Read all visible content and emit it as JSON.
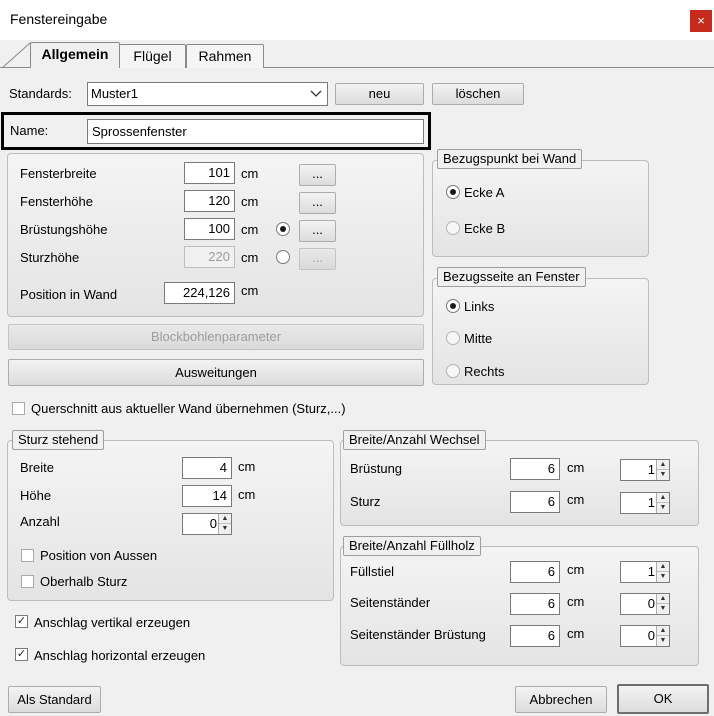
{
  "window": {
    "title": "Fenstereingabe",
    "close_label": "×"
  },
  "tabs": [
    {
      "label": "Allgemein"
    },
    {
      "label": "Flügel"
    },
    {
      "label": "Rahmen"
    }
  ],
  "standards": {
    "label": "Standards:",
    "value": "Muster1",
    "new_label": "neu",
    "delete_label": "löschen"
  },
  "name": {
    "label": "Name:",
    "value": "Sprossenfenster"
  },
  "dimensions": {
    "fensterbreite": {
      "label": "Fensterbreite",
      "value": "101",
      "unit": "cm",
      "dots": "..."
    },
    "fensterhoehe": {
      "label": "Fensterhöhe",
      "value": "120",
      "unit": "cm",
      "dots": "..."
    },
    "bruestungshoehe": {
      "label": "Brüstungshöhe",
      "value": "100",
      "unit": "cm",
      "dots": "..."
    },
    "sturzhoehe": {
      "label": "Sturzhöhe",
      "value": "220",
      "unit": "cm",
      "dots": "..."
    },
    "position_in_wand": {
      "label": "Position in Wand",
      "value": "224,126",
      "unit": "cm"
    }
  },
  "buttons": {
    "blockbohlen": "Blockbohlenparameter",
    "ausweitungen": "Ausweitungen",
    "als_standard": "Als Standard",
    "abbrechen": "Abbrechen",
    "ok": "OK"
  },
  "bezugspunkt": {
    "legend": "Bezugspunkt bei Wand",
    "options": [
      "Ecke A",
      "Ecke B"
    ],
    "selected": "Ecke A"
  },
  "bezugsseite": {
    "legend": "Bezugsseite an Fenster",
    "options": [
      "Links",
      "Mitte",
      "Rechts"
    ],
    "selected": "Links"
  },
  "querschnitt": {
    "label": "Querschnitt aus aktueller Wand übernehmen (Sturz,...)",
    "checked": false
  },
  "sturz": {
    "legend": "Sturz stehend",
    "breite": {
      "label": "Breite",
      "value": "4",
      "unit": "cm"
    },
    "hoehe": {
      "label": "Höhe",
      "value": "14",
      "unit": "cm"
    },
    "anzahl": {
      "label": "Anzahl",
      "value": "0"
    },
    "position_von_aussen": {
      "label": "Position von Aussen",
      "checked": false
    },
    "oberhalb_sturz": {
      "label": "Oberhalb Sturz",
      "checked": false
    }
  },
  "anschlag": {
    "vertikal": {
      "label": "Anschlag vertikal erzeugen",
      "checked": true
    },
    "horizontal": {
      "label": "Anschlag horizontal erzeugen",
      "checked": true
    }
  },
  "wechsel": {
    "legend": "Breite/Anzahl Wechsel",
    "bruestung": {
      "label": "Brüstung",
      "value": "6",
      "unit": "cm",
      "count": "1"
    },
    "sturz": {
      "label": "Sturz",
      "value": "6",
      "unit": "cm",
      "count": "1"
    }
  },
  "fuellholz": {
    "legend": "Breite/Anzahl Füllholz",
    "fuellstiel": {
      "label": "Füllstiel",
      "value": "6",
      "unit": "cm",
      "count": "1"
    },
    "seitenstaender": {
      "label": "Seitenständer",
      "value": "6",
      "unit": "cm",
      "count": "0"
    },
    "seitenstaender_bruestung": {
      "label": "Seitenständer Brüstung",
      "value": "6",
      "unit": "cm",
      "count": "0"
    }
  },
  "icons": {
    "check": "✓",
    "arrow_up": "▲",
    "arrow_down": "▼",
    "chevron": "chevron-down"
  }
}
